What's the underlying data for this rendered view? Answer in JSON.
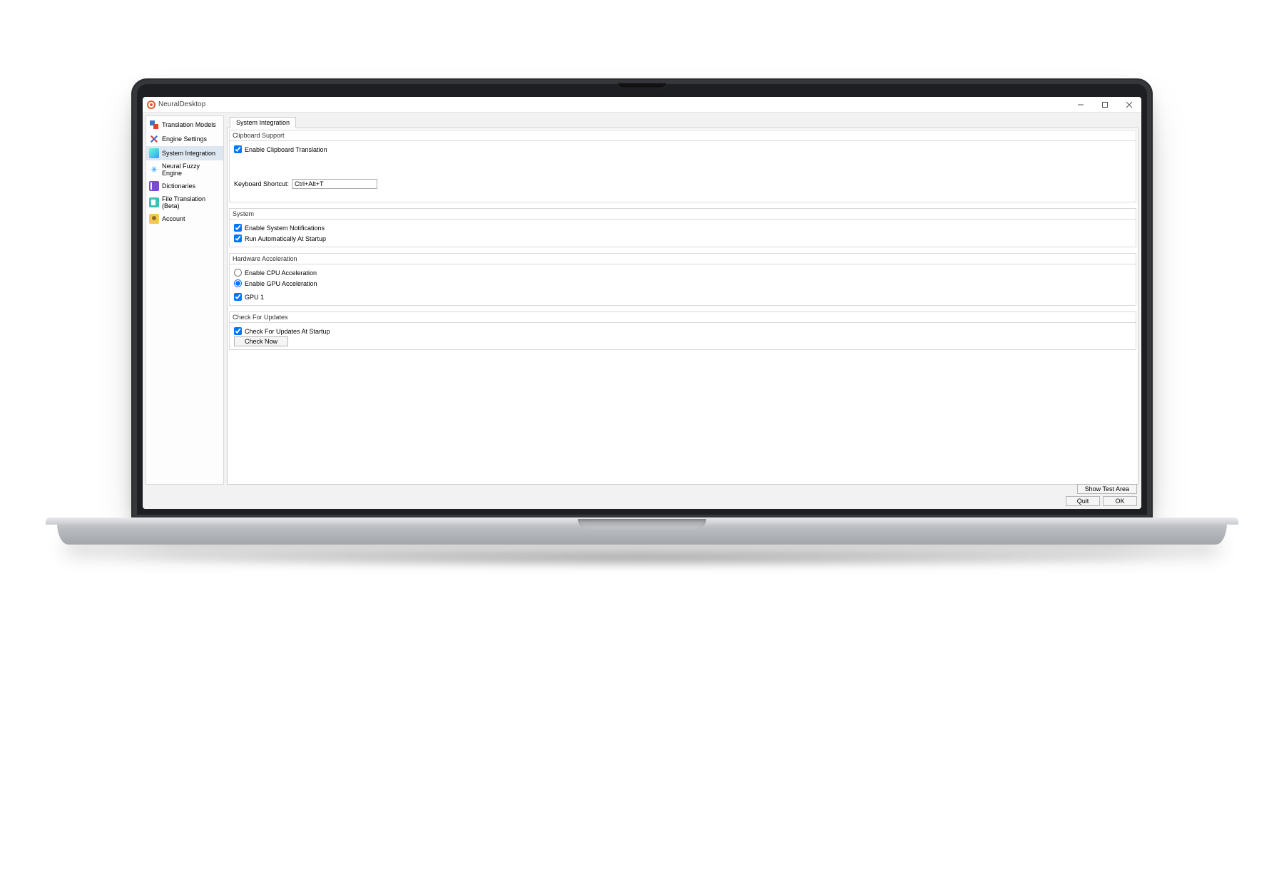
{
  "window": {
    "title": "NeuralDesktop"
  },
  "sidebar": {
    "items": [
      {
        "label": "Translation Models"
      },
      {
        "label": "Engine Settings"
      },
      {
        "label": "System Integration"
      },
      {
        "label": "Neural Fuzzy Engine"
      },
      {
        "label": "Dictionaries"
      },
      {
        "label": "File Translation (Beta)"
      },
      {
        "label": "Account"
      }
    ]
  },
  "tabs": {
    "active": "System Integration"
  },
  "clipboard": {
    "group_title": "Clipboard Support",
    "enable_label": "Enable Clipboard Translation",
    "enable_checked": true,
    "shortcut_label": "Keyboard Shortcut:",
    "shortcut_value": "Ctrl+Alt+T"
  },
  "system": {
    "group_title": "System",
    "notify_label": "Enable System Notifications",
    "notify_checked": true,
    "startup_label": "Run Automatically At Startup",
    "startup_checked": true
  },
  "hardware": {
    "group_title": "Hardware Acceleration",
    "cpu_label": "Enable CPU Acceleration",
    "gpu_label": "Enable GPU Acceleration",
    "selected": "gpu",
    "gpu1_label": "GPU 1",
    "gpu1_checked": true
  },
  "updates": {
    "group_title": "Check For Updates",
    "startup_check_label": "Check For Updates At Startup",
    "startup_check_checked": true,
    "check_now_label": "Check Now"
  },
  "footer": {
    "show_test_area": "Show Test Area",
    "quit": "Quit",
    "ok": "OK"
  }
}
